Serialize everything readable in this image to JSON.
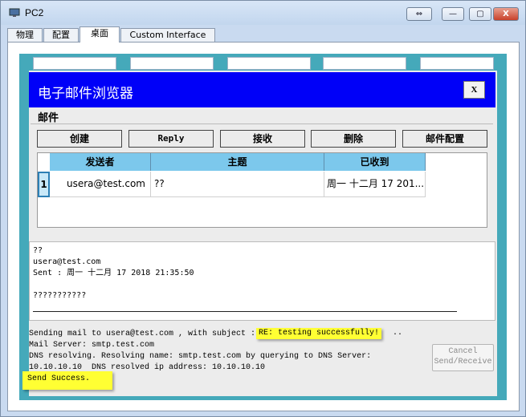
{
  "window": {
    "title": "PC2",
    "buttons": {
      "restore": "⇔",
      "minimize": "—",
      "maximize": "▢",
      "close": "X"
    }
  },
  "tabs": [
    "物理",
    "配置",
    "桌面",
    "Custom Interface"
  ],
  "active_tab": "桌面",
  "dialog": {
    "title": "电子邮件浏览器",
    "close_label": "X",
    "section_label": "邮件",
    "buttons": {
      "create": "创建",
      "reply": "Reply",
      "receive": "接收",
      "delete": "删除",
      "config": "邮件配置"
    },
    "table": {
      "headers": [
        "发送者",
        "主题",
        "已收到"
      ],
      "rows": [
        {
          "index": "1",
          "sender": "usera@test.com",
          "subject": "??",
          "received": "周一 十二月 17 201..."
        }
      ]
    },
    "message": {
      "subject": "??",
      "from": "usera@test.com",
      "sent": "Sent : 周一 十二月 17 2018 21:35:50",
      "body": "???????????"
    },
    "status": {
      "line1_prefix": "Sending mail to usera@test.com , with subject : ",
      "line1_subject": "RE: testing successfully!",
      "line1_suffix": " ..",
      "line2": "Mail Server: smtp.test.com",
      "line3": "DNS resolving. Resolving name: smtp.test.com by querying to DNS Server:",
      "line4": "10.10.10.10  DNS resolved ip address: 10.10.10.10",
      "line5": "Send Success."
    },
    "cancel_button": {
      "line1": "Cancel",
      "line2": "Send/Receive"
    }
  },
  "colors": {
    "dialog_header": "#0000f8",
    "desktop_bg": "#45a9ba",
    "table_header": "#7cc8ec",
    "highlight": "#ffff33"
  }
}
